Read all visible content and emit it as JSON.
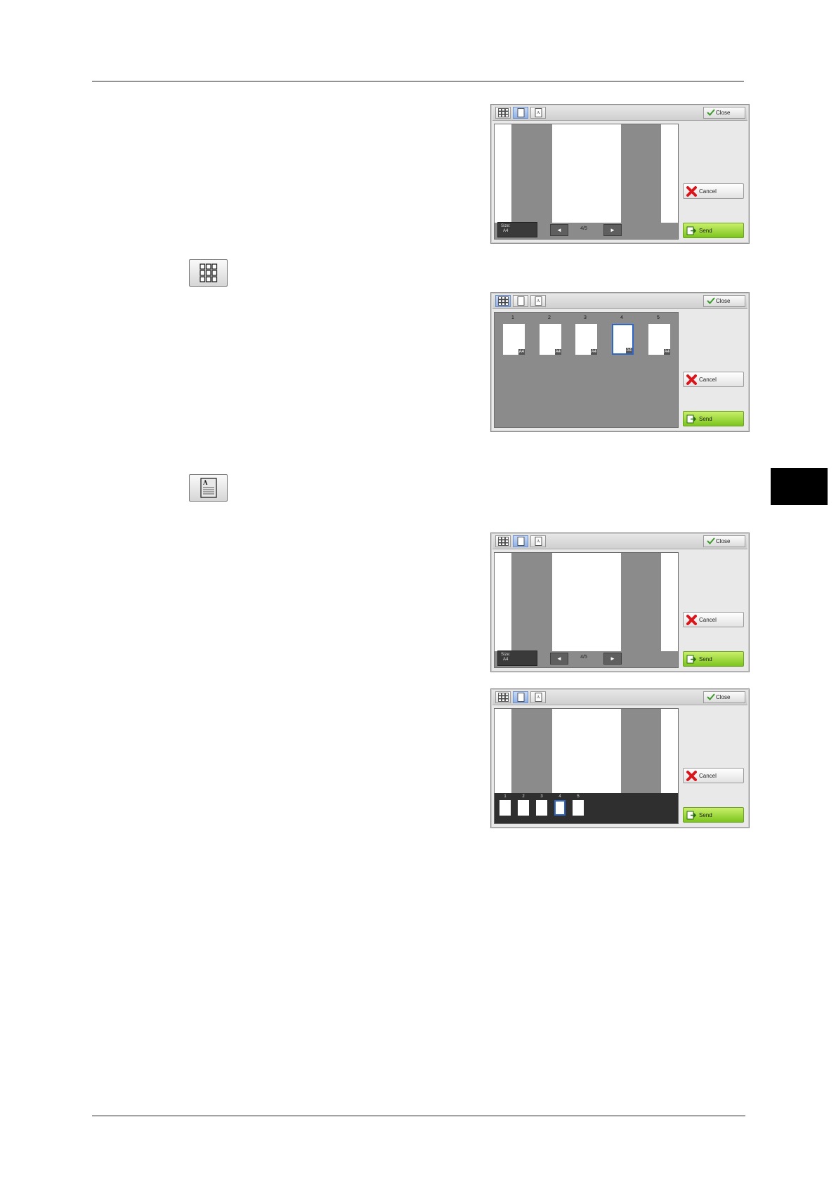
{
  "icons": {
    "thumbnail_view": "thumbnail-grid-icon",
    "page_view": "single-page-icon",
    "text_view": "text-page-icon",
    "close": "checkmark-icon",
    "cancel": "red-x-icon",
    "send": "send-arrow-icon"
  },
  "colors": {
    "send_green": "#7cc51e",
    "selected_blue": "#2f67c9",
    "viewer_gray": "#8b8b8b"
  },
  "screens": [
    {
      "close_label": "Close",
      "cancel_label": "Cancel",
      "send_label": "Send",
      "size_label": "Size:",
      "size_value": "A4",
      "page_indicator": "4/5",
      "prev_arrow": "◄",
      "next_arrow": "►"
    },
    {
      "close_label": "Close",
      "cancel_label": "Cancel",
      "send_label": "Send",
      "thumbnails": [
        {
          "number": "1",
          "size": "A4"
        },
        {
          "number": "2",
          "size": "A4"
        },
        {
          "number": "3",
          "size": "A4"
        },
        {
          "number": "4",
          "size": "A4"
        },
        {
          "number": "5",
          "size": "A4"
        }
      ],
      "selected_page": "4"
    },
    {
      "close_label": "Close",
      "cancel_label": "Cancel",
      "send_label": "Send",
      "size_label": "Size:",
      "size_value": "A4",
      "page_indicator": "4/5",
      "prev_arrow": "◄",
      "next_arrow": "►"
    },
    {
      "close_label": "Close",
      "cancel_label": "Cancel",
      "send_label": "Send",
      "strip_pages": [
        "1",
        "2",
        "3",
        "4",
        "5"
      ],
      "selected_page": "4"
    }
  ]
}
